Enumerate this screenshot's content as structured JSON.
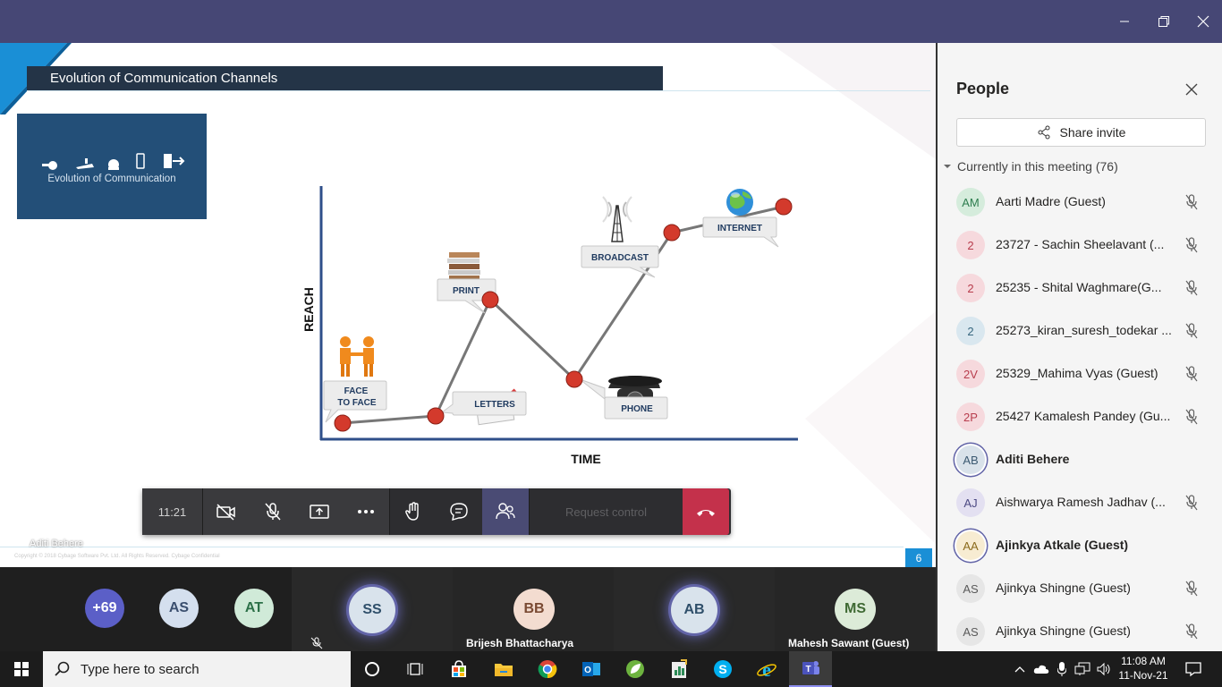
{
  "slide": {
    "title": "Evolution of Communication Channels",
    "thumbnail_caption": "Evolution of Communication",
    "presenter_overlay": "Aditi Behere",
    "copyright": "Copyright © 2018 Cybage Software Pvt. Ltd. All Rights Reserved. Cybage Confidential",
    "page_number": "6",
    "chart": {
      "y_axis_label": "REACH",
      "x_axis_label": "TIME",
      "milestones": [
        {
          "label_line1": "FACE",
          "label_line2": "TO FACE",
          "icon": "handshake-people-icon"
        },
        {
          "label_line1": "LETTERS",
          "label_line2": "",
          "icon": "letters-icon"
        },
        {
          "label_line1": "PRINT",
          "label_line2": "",
          "icon": "book-stack-icon"
        },
        {
          "label_line1": "PHONE",
          "label_line2": "",
          "icon": "rotary-phone-icon"
        },
        {
          "label_line1": "BROADCAST",
          "label_line2": "",
          "icon": "broadcast-tower-icon"
        },
        {
          "label_line1": "INTERNET",
          "label_line2": "",
          "icon": "globe-icon"
        }
      ]
    }
  },
  "controls": {
    "meeting_time": "11:21",
    "request_control": "Request control"
  },
  "strip": {
    "overflow_count": "+69",
    "tiles": [
      {
        "initials": "AS",
        "name": ""
      },
      {
        "initials": "AT",
        "name": ""
      },
      {
        "initials": "SS",
        "name": ""
      },
      {
        "initials": "BB",
        "name": "Brijesh Bhattacharya"
      },
      {
        "initials": "AB",
        "name": ""
      },
      {
        "initials": "MS",
        "name": "Mahesh Sawant (Guest)"
      }
    ]
  },
  "people": {
    "title": "People",
    "share_invite": "Share invite",
    "section_header": "Currently in this meeting (76)",
    "participants": [
      {
        "initials": "AM",
        "name": "Aarti Madre (Guest)",
        "muted": true,
        "bold": false,
        "color": "#d5ecdc",
        "text_color": "#2e7d4f"
      },
      {
        "initials": "2",
        "name": "23727 - Sachin Sheelavant (...",
        "muted": true,
        "bold": false,
        "color": "#f6d9dd",
        "text_color": "#b83d4d"
      },
      {
        "initials": "2",
        "name": "25235 - Shital Waghmare(G...",
        "muted": true,
        "bold": false,
        "color": "#f6d9dd",
        "text_color": "#b83d4d"
      },
      {
        "initials": "2",
        "name": "25273_kiran_suresh_todekar ...",
        "muted": true,
        "bold": false,
        "color": "#d9e7ef",
        "text_color": "#38677f"
      },
      {
        "initials": "2V",
        "name": "25329_Mahima Vyas (Guest)",
        "muted": true,
        "bold": false,
        "color": "#f6d9dd",
        "text_color": "#b83d4d"
      },
      {
        "initials": "2P",
        "name": "25427 Kamalesh Pandey (Gu...",
        "muted": true,
        "bold": false,
        "color": "#f6d9dd",
        "text_color": "#b83d4d"
      },
      {
        "initials": "AB",
        "name": "Aditi Behere",
        "muted": false,
        "bold": true,
        "color": "#d9e2ea",
        "text_color": "#3c5a72"
      },
      {
        "initials": "AJ",
        "name": "Aishwarya Ramesh Jadhav (...",
        "muted": true,
        "bold": false,
        "color": "#e3e0f1",
        "text_color": "#4c4a83"
      },
      {
        "initials": "AA",
        "name": "Ajinkya Atkale (Guest)",
        "muted": false,
        "bold": true,
        "color": "#f7ecd2",
        "text_color": "#8a6a1c"
      },
      {
        "initials": "AS",
        "name": "Ajinkya Shingne (Guest)",
        "muted": true,
        "bold": false,
        "color": "#e6e6e6",
        "text_color": "#5a5a5a"
      },
      {
        "initials": "AS",
        "name": "Ajinkya Shingne (Guest)",
        "muted": true,
        "bold": false,
        "color": "#e6e6e6",
        "text_color": "#5a5a5a"
      }
    ]
  },
  "taskbar": {
    "search_placeholder": "Type here to search",
    "time": "11:08 AM",
    "date": "11-Nov-21"
  }
}
